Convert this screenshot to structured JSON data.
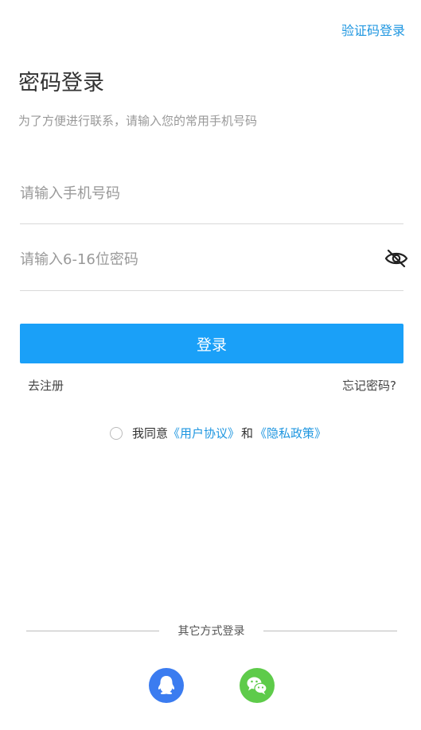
{
  "header": {
    "switch_label": "验证码登录"
  },
  "main": {
    "title": "密码登录",
    "subtitle": "为了方便进行联系，请输入您的常用手机号码"
  },
  "form": {
    "phone_placeholder": "请输入手机号码",
    "phone_value": "",
    "password_placeholder": "请输入6-16位密码",
    "password_value": "",
    "password_toggle_icon": "eye-off-icon",
    "login_label": "登录"
  },
  "links": {
    "register_label": "去注册",
    "forgot_label": "忘记密码?"
  },
  "agreement": {
    "prefix": "我同意",
    "user_agreement": "《用户协议》",
    "and": "和",
    "privacy_policy": "《隐私政策》"
  },
  "other_login": {
    "label": "其它方式登录",
    "methods": [
      {
        "icon": "qq-icon",
        "color": "#3b7cf0"
      },
      {
        "icon": "wechat-icon",
        "color": "#5ecb4a"
      }
    ]
  },
  "colors": {
    "accent": "#1aa0f8",
    "link": "#1e96e0"
  }
}
